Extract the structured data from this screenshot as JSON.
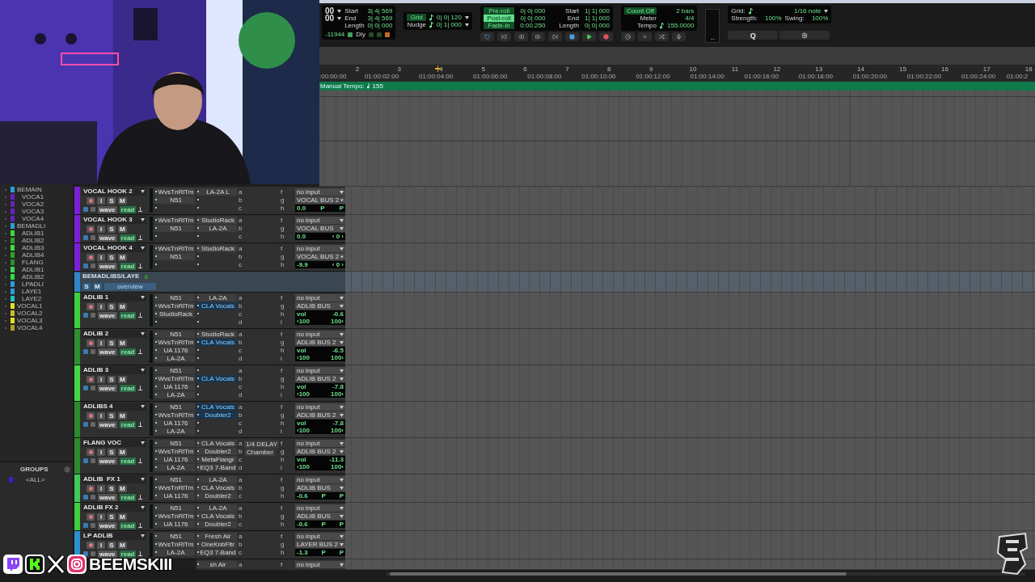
{
  "transport": {
    "counter": [
      "00",
      "00"
    ],
    "selection": [
      {
        "label": "Start",
        "value": "3| 4| 569"
      },
      {
        "label": "End",
        "value": "3| 4| 569"
      },
      {
        "label": "Length",
        "value": "0| 0| 000"
      }
    ],
    "samples": "-11944",
    "delay": "Dly",
    "grid": {
      "label": "Grid",
      "value": "0| 0| 120"
    },
    "nudge": {
      "label": "Nudge",
      "value": "0| 1| 000"
    },
    "rolls": [
      {
        "label": "Pre-roll",
        "value": "0| 0| 000",
        "on": false
      },
      {
        "label": "Post-roll",
        "value": "0| 0| 000",
        "on": true
      },
      {
        "label": "Fade-in",
        "value": "0:00.250",
        "on": false
      }
    ],
    "locations": [
      {
        "label": "Start",
        "value": "1| 1| 000"
      },
      {
        "label": "End",
        "value": "1| 1| 000"
      },
      {
        "label": "Length",
        "value": "0| 0| 000"
      }
    ],
    "count_off": {
      "label": "Count Off",
      "value": "2 bars"
    },
    "meter": {
      "label": "Meter",
      "value": "4/4"
    },
    "tempo": {
      "label": "Tempo",
      "value": "155.0000"
    },
    "meter_reading": "--",
    "quantize": {
      "grid_label": "Grid:",
      "grid_value": "1/16 note",
      "strength_label": "Strength:",
      "strength": "100%",
      "swing_label": "Swing:",
      "swing": "100%",
      "button": "Q"
    }
  },
  "ruler": {
    "bars": [
      "2",
      "3",
      "4",
      "5",
      "6",
      "7",
      "8",
      "9",
      "10",
      "11",
      "12",
      "13",
      "14",
      "15",
      "16",
      "17",
      "18"
    ],
    "timecodes": [
      ":00:00:00",
      "01:00:02:00",
      "01:00:04:00",
      "01:00:06:00",
      "01:00:08:00",
      "01:00:10:00",
      "01:00:12:00",
      "01:00:14:00",
      "01:00:16:00",
      "01:00:18:00",
      "01:00:20:00",
      "01:00:22:00",
      "01:00:24:00",
      "01:00:2"
    ],
    "tempo_label": "Manual Tempo:",
    "tempo_value": "155"
  },
  "track_list": [
    {
      "name": "BEMAIN",
      "color": "#2a9fd8",
      "children": [
        {
          "name": "VOCA1",
          "color": "#6a1fc0"
        },
        {
          "name": "VOCA2",
          "color": "#6a1fc0"
        },
        {
          "name": "VOCA3",
          "color": "#6a1fc0"
        },
        {
          "name": "VOCA4",
          "color": "#6a1fc0"
        }
      ]
    },
    {
      "name": "BEMADLI",
      "color": "#2a9fd8",
      "children": [
        {
          "name": "ADLIB1",
          "color": "#3fd83f"
        },
        {
          "name": "ADLIB2",
          "color": "#2f9f2f"
        },
        {
          "name": "ADLIB3",
          "color": "#3fe03f"
        },
        {
          "name": "ADLIB4",
          "color": "#2fa02f"
        },
        {
          "name": "FLANG",
          "color": "#2f8f2f"
        },
        {
          "name": "ADLIB1",
          "color": "#3fd860"
        },
        {
          "name": "ADLIB2",
          "color": "#30e040"
        },
        {
          "name": "LPADLI",
          "color": "#2a9fd8"
        },
        {
          "name": "LAYE1",
          "color": "#2a9fd8"
        },
        {
          "name": "LAYE2",
          "color": "#2abfc0"
        }
      ]
    },
    {
      "name": "VOCAL1",
      "color": "#e8e020"
    },
    {
      "name": "VOCAL2",
      "color": "#c8c020"
    },
    {
      "name": "VOCAL3",
      "color": "#e0e020"
    },
    {
      "name": "VOCAL4",
      "color": "#b0a020"
    }
  ],
  "groups": {
    "title": "GROUPS",
    "items": [
      {
        "name": "<ALL>",
        "color": "#3a1fd0"
      }
    ]
  },
  "tracks": [
    {
      "kind": "track",
      "name": "VOCAL HOOK 2",
      "color": "#7b1fd6",
      "buttons": [
        "I",
        "S",
        "M"
      ],
      "view": "wave",
      "auto": "read",
      "inserts_a": [
        {
          "kind": "plugin",
          "name": "WvsTnRlTm"
        },
        {
          "kind": "plugin",
          "name": "N51"
        },
        {
          "kind": "empty"
        }
      ],
      "inserts_b": [
        {
          "kind": "plugin",
          "name": "LA-2A L"
        },
        {
          "kind": "empty"
        },
        {
          "kind": "empty"
        }
      ],
      "sends_a": [
        "a",
        "b",
        "c"
      ],
      "sends_b": [
        "f",
        "g",
        "h"
      ],
      "input": "no input",
      "output": "VOCAL BUS 2",
      "display": {
        "kind": "pan",
        "value": "0.0",
        "pan": [
          "P",
          "P"
        ]
      }
    },
    {
      "kind": "track",
      "name": "VOCAL HOOK 3",
      "color": "#7b1fd6",
      "buttons": [
        "I",
        "S",
        "M"
      ],
      "view": "wave",
      "auto": "read",
      "inserts_a": [
        {
          "kind": "plugin",
          "name": "WvsTnRlTm"
        },
        {
          "kind": "plugin",
          "name": "N51"
        },
        {
          "kind": "empty"
        }
      ],
      "inserts_b": [
        {
          "kind": "plugin",
          "name": "StudioRack"
        },
        {
          "kind": "plugin",
          "name": "LA-2A"
        },
        {
          "kind": "empty"
        }
      ],
      "sends_a": [
        "a",
        "b",
        "c"
      ],
      "sends_b": [
        "f",
        "g",
        "h"
      ],
      "input": "no input",
      "output": "VOCAL BUS",
      "display": {
        "kind": "pan",
        "value": "0.0",
        "pan": [
          "‹ 0 ›"
        ]
      }
    },
    {
      "kind": "track",
      "name": "VOCAL HOOK 4",
      "color": "#7b1fd6",
      "buttons": [
        "I",
        "S",
        "M"
      ],
      "view": "wave",
      "auto": "read",
      "inserts_a": [
        {
          "kind": "plugin",
          "name": "WvsTnRlTm"
        },
        {
          "kind": "plugin",
          "name": "N51"
        },
        {
          "kind": "empty"
        }
      ],
      "inserts_b": [
        {
          "kind": "plugin",
          "name": "StudioRack"
        },
        {
          "kind": "empty"
        },
        {
          "kind": "empty"
        }
      ],
      "sends_a": [
        "a",
        "b",
        "c"
      ],
      "sends_b": [
        "f",
        "g",
        "h"
      ],
      "input": "no input",
      "output": "VOCAL BUS 2",
      "display": {
        "kind": "pan",
        "value": "-9.9",
        "pan": [
          "‹ 0 ›"
        ]
      }
    },
    {
      "kind": "folder",
      "name": "BEMADLIBS/LAYE",
      "color": "#2f86c8",
      "count": "8",
      "buttons": [
        "S",
        "M"
      ],
      "view": "overview"
    },
    {
      "kind": "track",
      "name": "ADLIB 1",
      "color": "#3ed13e",
      "buttons": [
        "I",
        "S",
        "M"
      ],
      "view": "wave",
      "auto": "read",
      "inserts_a": [
        {
          "kind": "plugin",
          "name": "N51"
        },
        {
          "kind": "plugin",
          "name": "WvsTnRlTm"
        },
        {
          "kind": "plugin",
          "name": "StudioRack"
        },
        {
          "kind": "empty"
        }
      ],
      "inserts_b": [
        {
          "kind": "plugin",
          "name": "LA-2A"
        },
        {
          "kind": "highlight",
          "name": "CLA Vocals"
        },
        {
          "kind": "empty"
        },
        {
          "kind": "empty"
        }
      ],
      "sends_a": [
        "a",
        "b",
        "c",
        "d"
      ],
      "sends_b": [
        "f",
        "g",
        "h",
        "i"
      ],
      "input": "no input",
      "output": "ADLIB BUS",
      "display": {
        "kind": "vol",
        "label": "vol",
        "value": "-0.6",
        "pan": [
          "‹100",
          "100›"
        ]
      }
    },
    {
      "kind": "track",
      "name": "ADLIB 2",
      "color": "#2e8f2e",
      "buttons": [
        "I",
        "S",
        "M"
      ],
      "view": "wave",
      "auto": "read",
      "inserts_a": [
        {
          "kind": "plugin",
          "name": "N51"
        },
        {
          "kind": "plugin",
          "name": "WvsTnRlTm"
        },
        {
          "kind": "plugin",
          "name": "UA 1176"
        },
        {
          "kind": "plugin",
          "name": "LA-2A"
        }
      ],
      "inserts_b": [
        {
          "kind": "plugin",
          "name": "StudioRack"
        },
        {
          "kind": "highlight",
          "name": "CLA Vocals"
        },
        {
          "kind": "empty"
        },
        {
          "kind": "empty"
        }
      ],
      "sends_a": [
        "a",
        "b",
        "c",
        "d"
      ],
      "sends_b": [
        "f",
        "g",
        "h",
        "i"
      ],
      "input": "no input",
      "output": "ADLIB BUS 2",
      "display": {
        "kind": "vol",
        "label": "vol",
        "value": "-6.5",
        "pan": [
          "‹100",
          "100›"
        ]
      }
    },
    {
      "kind": "track",
      "name": "ADLIB 3",
      "color": "#43d843",
      "buttons": [
        "I",
        "S",
        "M"
      ],
      "view": "wave",
      "auto": "read",
      "inserts_a": [
        {
          "kind": "plugin",
          "name": "N51"
        },
        {
          "kind": "plugin",
          "name": "WvsTnRlTm"
        },
        {
          "kind": "plugin",
          "name": "UA 1176"
        },
        {
          "kind": "plugin",
          "name": "LA-2A"
        }
      ],
      "inserts_b": [
        {
          "kind": "empty"
        },
        {
          "kind": "highlight",
          "name": "CLA Vocals"
        },
        {
          "kind": "empty"
        },
        {
          "kind": "empty"
        }
      ],
      "sends_a": [
        "a",
        "b",
        "c",
        "d"
      ],
      "sends_b": [
        "f",
        "g",
        "h",
        "i"
      ],
      "input": "no input",
      "output": "ADLIB BUS 2",
      "display": {
        "kind": "vol",
        "label": "vol",
        "value": "-7.8",
        "pan": [
          "‹100",
          "100›"
        ]
      }
    },
    {
      "kind": "track",
      "name": "ADLIBS 4",
      "color": "#2c8a2c",
      "buttons": [
        "I",
        "S",
        "M"
      ],
      "view": "wave",
      "auto": "read",
      "inserts_a": [
        {
          "kind": "plugin",
          "name": "N51"
        },
        {
          "kind": "plugin",
          "name": "WvsTnRlTm"
        },
        {
          "kind": "plugin",
          "name": "UA 1176"
        },
        {
          "kind": "plugin",
          "name": "LA-2A"
        }
      ],
      "inserts_b": [
        {
          "kind": "highlight",
          "name": "CLA Vocals"
        },
        {
          "kind": "highlight",
          "name": "Doubler2"
        },
        {
          "kind": "empty"
        },
        {
          "kind": "empty"
        }
      ],
      "sends_a": [
        "a",
        "b",
        "c",
        "d"
      ],
      "sends_b": [
        "f",
        "g",
        "h",
        "i"
      ],
      "input": "no input",
      "output": "ADLIB BUS 2",
      "display": {
        "kind": "vol",
        "label": "vol",
        "value": "-7.8",
        "pan": [
          "‹100",
          "100›"
        ]
      }
    },
    {
      "kind": "track",
      "name": "FLANG VOC",
      "color": "#2c8a2c",
      "buttons": [
        "I",
        "S",
        "M"
      ],
      "view": "wave",
      "auto": "read",
      "inserts_a": [
        {
          "kind": "plugin",
          "name": "N51"
        },
        {
          "kind": "plugin",
          "name": "WvsTnRlTm"
        },
        {
          "kind": "plugin",
          "name": "UA 1176"
        },
        {
          "kind": "plugin",
          "name": "LA-2A"
        }
      ],
      "inserts_b": [
        {
          "kind": "plugin",
          "name": "CLA Vocals"
        },
        {
          "kind": "plugin",
          "name": "Doubler2"
        },
        {
          "kind": "plugin",
          "name": "MetaFlangr"
        },
        {
          "kind": "plugin",
          "name": "EQ3 7-Band"
        }
      ],
      "sends_a": [
        "a",
        "b",
        "c",
        "d"
      ],
      "send_names": [
        "1/4 DELAY",
        "Chamber"
      ],
      "sends_b": [
        "f",
        "g",
        "h",
        "i"
      ],
      "input": "no input",
      "output": "ADLIB BUS 2",
      "display": {
        "kind": "vol",
        "label": "vol",
        "value": "-11.3",
        "pan": [
          "‹100",
          "100›"
        ]
      }
    },
    {
      "kind": "track",
      "name": "ADLIB  FX 1",
      "color": "#41c95a",
      "buttons": [
        "I",
        "S",
        "M"
      ],
      "view": "wave",
      "auto": "read",
      "inserts_a": [
        {
          "kind": "plugin",
          "name": "N51"
        },
        {
          "kind": "plugin",
          "name": "WvsTnRlTm"
        },
        {
          "kind": "plugin",
          "name": "UA 1176"
        }
      ],
      "inserts_b": [
        {
          "kind": "plugin",
          "name": "LA-2A"
        },
        {
          "kind": "plugin",
          "name": "CLA Vocals"
        },
        {
          "kind": "plugin",
          "name": "Doubler2"
        }
      ],
      "sends_a": [
        "a",
        "b",
        "c"
      ],
      "sends_b": [
        "f",
        "g",
        "h"
      ],
      "input": "no input",
      "output": "ADLIB BUS",
      "display": {
        "kind": "pan",
        "value": "-0.6",
        "pan": [
          "P",
          "P"
        ]
      }
    },
    {
      "kind": "track",
      "name": "ADLIB FX 2",
      "color": "#3fcf3f",
      "buttons": [
        "I",
        "S",
        "M"
      ],
      "view": "wave",
      "auto": "read",
      "inserts_a": [
        {
          "kind": "plugin",
          "name": "N51"
        },
        {
          "kind": "plugin",
          "name": "WvsTnRlTm"
        },
        {
          "kind": "plugin",
          "name": "UA 1176"
        }
      ],
      "inserts_b": [
        {
          "kind": "plugin",
          "name": "LA-2A"
        },
        {
          "kind": "plugin",
          "name": "CLA Vocals"
        },
        {
          "kind": "plugin",
          "name": "Doubler2"
        }
      ],
      "sends_a": [
        "a",
        "b",
        "c"
      ],
      "sends_b": [
        "f",
        "g",
        "h"
      ],
      "input": "no input",
      "output": "ADLIB BUS",
      "display": {
        "kind": "pan",
        "value": "-0.6",
        "pan": [
          "P",
          "P"
        ]
      }
    },
    {
      "kind": "track",
      "name": "LP ADLIB",
      "color": "#2a90d0",
      "buttons": [
        "I",
        "S",
        "M"
      ],
      "view": "wave",
      "auto": "read",
      "inserts_a": [
        {
          "kind": "plugin",
          "name": "N51"
        },
        {
          "kind": "plugin",
          "name": "WvsTnRlTm"
        },
        {
          "kind": "plugin",
          "name": "LA-2A"
        }
      ],
      "inserts_b": [
        {
          "kind": "plugin",
          "name": "Fresh Air"
        },
        {
          "kind": "plugin",
          "name": "OneKnbFltr"
        },
        {
          "kind": "plugin",
          "name": "EQ3 7-Band"
        }
      ],
      "sends_a": [
        "a",
        "b",
        "c"
      ],
      "sends_b": [
        "f",
        "g",
        "h"
      ],
      "input": "no input",
      "output": "LAYER BUS 2",
      "display": {
        "kind": "pan",
        "value": "-1.3",
        "pan": [
          "P",
          "P"
        ]
      }
    },
    {
      "kind": "partial",
      "inserts_b": [
        {
          "kind": "plugin",
          "name": "sh Air"
        }
      ],
      "sends_a": [
        "a"
      ],
      "sends_b": [
        "f"
      ],
      "input": "no input"
    }
  ],
  "social": {
    "handle": "BEEMSKIII"
  }
}
